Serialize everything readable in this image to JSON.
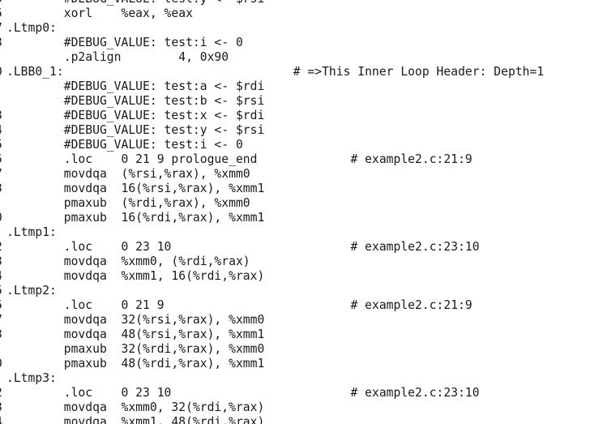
{
  "lines": [
    {
      "gutter": "5",
      "text": "        #DEBUG_VALUE: test:y <- $rsi"
    },
    {
      "gutter": "5",
      "text": "        xorl    %eax, %eax"
    },
    {
      "gutter": "7",
      "text": ".Ltmp0:"
    },
    {
      "gutter": "3",
      "text": "        #DEBUG_VALUE: test:i <- 0"
    },
    {
      "gutter": "",
      "text": "        .p2align        4, 0x90"
    },
    {
      "gutter": "0",
      "text": ".LBB0_1:                                # =>This Inner Loop Header: Depth=1"
    },
    {
      "gutter": "",
      "text": "        #DEBUG_VALUE: test:a <- $rdi"
    },
    {
      "gutter": "",
      "text": "        #DEBUG_VALUE: test:b <- $rsi"
    },
    {
      "gutter": "3",
      "text": "        #DEBUG_VALUE: test:x <- $rdi"
    },
    {
      "gutter": "4",
      "text": "        #DEBUG_VALUE: test:y <- $rsi"
    },
    {
      "gutter": "5",
      "text": "        #DEBUG_VALUE: test:i <- 0"
    },
    {
      "gutter": "5",
      "text": "        .loc    0 21 9 prologue_end             # example2.c:21:9"
    },
    {
      "gutter": "7",
      "text": "        movdqa  (%rsi,%rax), %xmm0"
    },
    {
      "gutter": "3",
      "text": "        movdqa  16(%rsi,%rax), %xmm1"
    },
    {
      "gutter": "",
      "text": "        pmaxub  (%rdi,%rax), %xmm0"
    },
    {
      "gutter": "0",
      "text": "        pmaxub  16(%rdi,%rax), %xmm1"
    },
    {
      "gutter": "",
      "text": ".Ltmp1:"
    },
    {
      "gutter": "2",
      "text": "        .loc    0 23 10                         # example2.c:23:10"
    },
    {
      "gutter": "3",
      "text": "        movdqa  %xmm0, (%rdi,%rax)"
    },
    {
      "gutter": "4",
      "text": "        movdqa  %xmm1, 16(%rdi,%rax)"
    },
    {
      "gutter": "5",
      "text": ".Ltmp2:"
    },
    {
      "gutter": "5",
      "text": "        .loc    0 21 9                          # example2.c:21:9"
    },
    {
      "gutter": "7",
      "text": "        movdqa  32(%rsi,%rax), %xmm0"
    },
    {
      "gutter": "3",
      "text": "        movdqa  48(%rsi,%rax), %xmm1"
    },
    {
      "gutter": "",
      "text": "        pmaxub  32(%rdi,%rax), %xmm0"
    },
    {
      "gutter": "0",
      "text": "        pmaxub  48(%rdi,%rax), %xmm1"
    },
    {
      "gutter": "",
      "text": ".Ltmp3:"
    },
    {
      "gutter": "2",
      "text": "        .loc    0 23 10                         # example2.c:23:10"
    },
    {
      "gutter": "3",
      "text": "        movdqa  %xmm0, 32(%rdi,%rax)"
    },
    {
      "gutter": "4",
      "text": "        movdqa  %xmm1, 48(%rdi,%rax)"
    }
  ]
}
